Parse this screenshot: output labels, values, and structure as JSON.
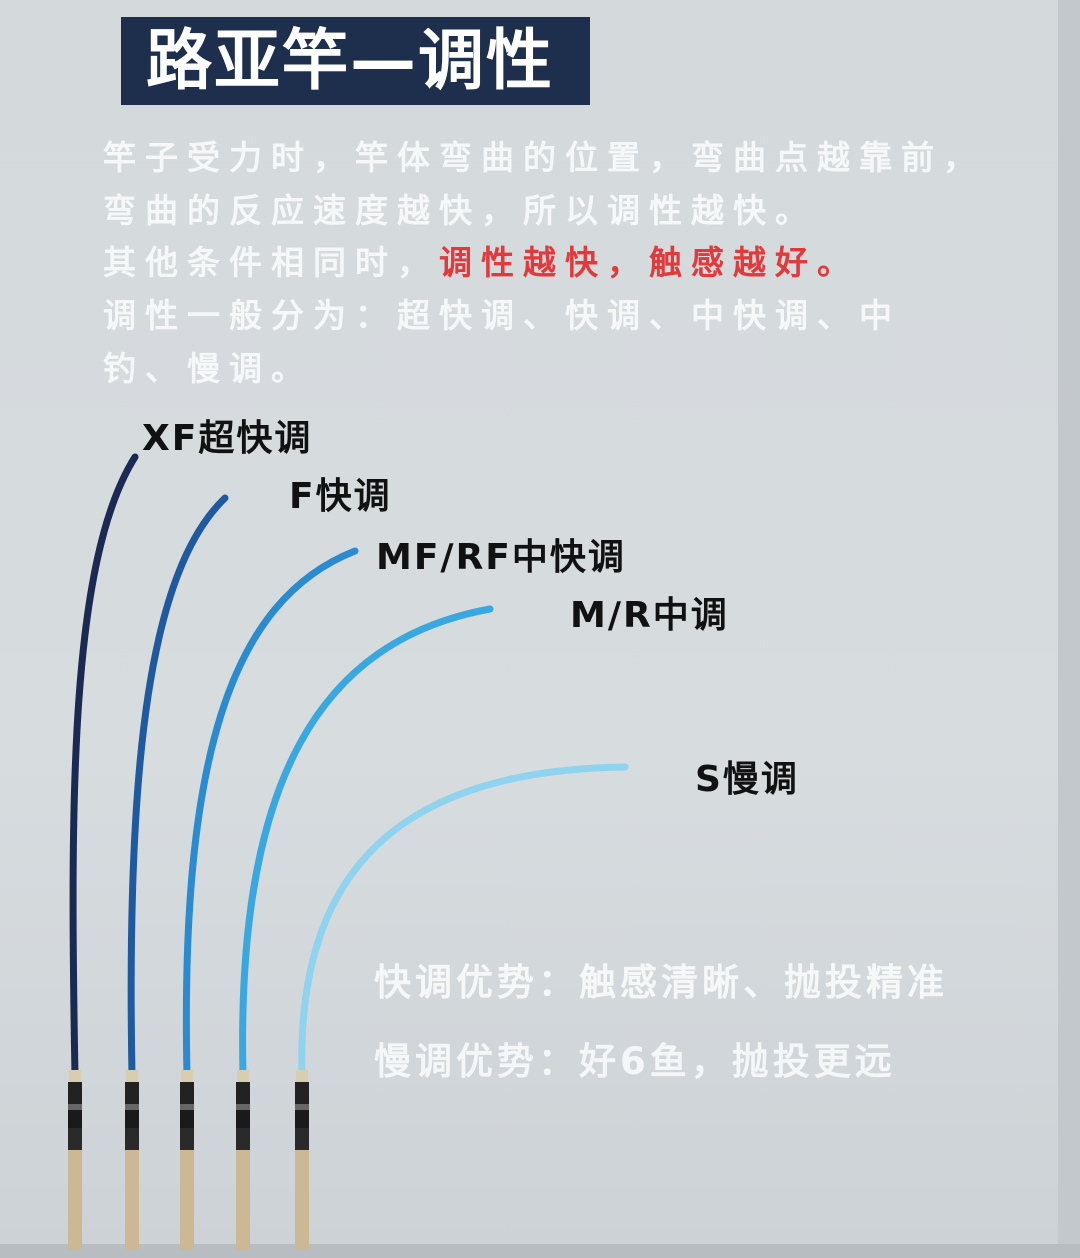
{
  "title": "路亚竿—调性",
  "paragraphs": {
    "line1": "竿子受力时，竿体弯曲的位置，弯曲点越靠前，",
    "line2": "弯曲的反应速度越快，所以调性越快。",
    "line3_lead": "其他条件相同时，",
    "line3_highlight": "调性越快，触感越好。",
    "line4": "调性一般分为：超快调、快调、中快调、中",
    "line5": "钓、慢调。"
  },
  "rods": [
    {
      "label": "XF超快调",
      "color": "#1a2a52"
    },
    {
      "label": "F快调",
      "color": "#1f5aa0"
    },
    {
      "label": "MF/RF中快调",
      "color": "#2a8bd0"
    },
    {
      "label": "M/R中调",
      "color": "#3aa8e0"
    },
    {
      "label": "S慢调",
      "color": "#8fd3ef"
    }
  ],
  "advantages": {
    "fast": "快调优势：触感清晰、抛投精准",
    "slow": "慢调优势：好6鱼，抛投更远"
  }
}
